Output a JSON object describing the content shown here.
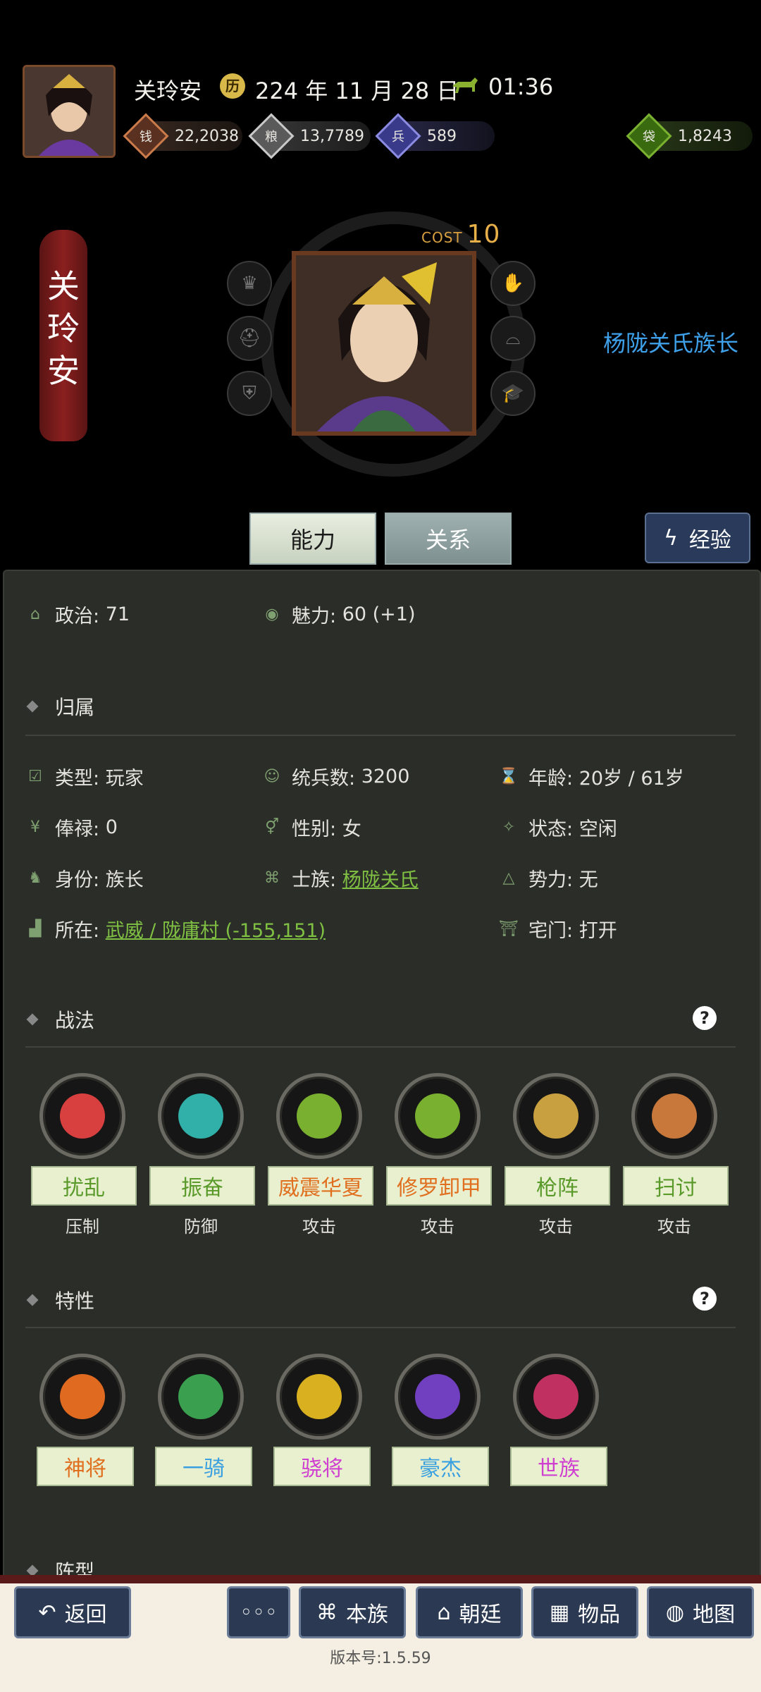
{
  "header": {
    "player_name": "关玲安",
    "date": "224 年 11 月 28 日",
    "time": "01:36"
  },
  "resources": [
    {
      "icon": "money-icon",
      "value": "22,2038"
    },
    {
      "icon": "grain-icon",
      "value": "13,7789"
    },
    {
      "icon": "soldier-icon",
      "value": "589"
    },
    {
      "icon": "bag-icon",
      "value": "1,8243"
    }
  ],
  "hero": {
    "name_chars": [
      "关",
      "玲",
      "安"
    ],
    "cost_label": "COST",
    "cost_value": "10",
    "title": "杨陇关氏族长"
  },
  "tabs": {
    "ability": "能力",
    "relation": "关系",
    "experience": "经验"
  },
  "stats_top": [
    {
      "label": "政治:",
      "value": "71"
    },
    {
      "label": "魅力:",
      "value": "60 (+1)"
    }
  ],
  "section_belong": "归属",
  "belong": {
    "type_label": "类型:",
    "type_value": "玩家",
    "troops_label": "统兵数:",
    "troops_value": "3200",
    "age_label": "年龄:",
    "age_value": "20岁 / 61岁",
    "salary_label": "俸禄:",
    "salary_value": "0",
    "gender_label": "性别:",
    "gender_value": "女",
    "status_label": "状态:",
    "status_value": "空闲",
    "identity_label": "身份:",
    "identity_value": "族长",
    "clan_label": "士族:",
    "clan_value": "杨陇关氏",
    "force_label": "势力:",
    "force_value": "无",
    "location_label": "所在:",
    "location_value": "武威 / 陇庸村 (-155,151)",
    "gate_label": "宅门:",
    "gate_value": "打开"
  },
  "section_tactics": "战法",
  "tactics": [
    {
      "name": "扰乱",
      "type": "压制",
      "color": "#5a9a2a",
      "core": "#d84040"
    },
    {
      "name": "振奋",
      "type": "防御",
      "color": "#5a9a2a",
      "core": "#30b0a8"
    },
    {
      "name": "威震华夏",
      "type": "攻击",
      "color": "#e07020",
      "core": "#7ab030"
    },
    {
      "name": "修罗卸甲",
      "type": "攻击",
      "color": "#e07020",
      "core": "#7ab030"
    },
    {
      "name": "枪阵",
      "type": "攻击",
      "color": "#5a9a2a",
      "core": "#c8a040"
    },
    {
      "name": "扫讨",
      "type": "攻击",
      "color": "#5a9a2a",
      "core": "#c8783a"
    }
  ],
  "section_traits": "特性",
  "traits": [
    {
      "name": "神将",
      "color": "#e07020",
      "core": "#e06a20"
    },
    {
      "name": "一骑",
      "color": "#3aa0e0",
      "core": "#3aa050"
    },
    {
      "name": "骁将",
      "color": "#d040d0",
      "core": "#d8b020"
    },
    {
      "name": "豪杰",
      "color": "#3aa0e0",
      "core": "#7040c0"
    },
    {
      "name": "世族",
      "color": "#d040d0",
      "core": "#c03060"
    }
  ],
  "section_formation": "阵型",
  "bottom_nav": {
    "back": "返回",
    "more": "◦◦◦",
    "clan": "本族",
    "court": "朝廷",
    "items": "物品",
    "map": "地图"
  },
  "version": "版本号:1.5.59"
}
